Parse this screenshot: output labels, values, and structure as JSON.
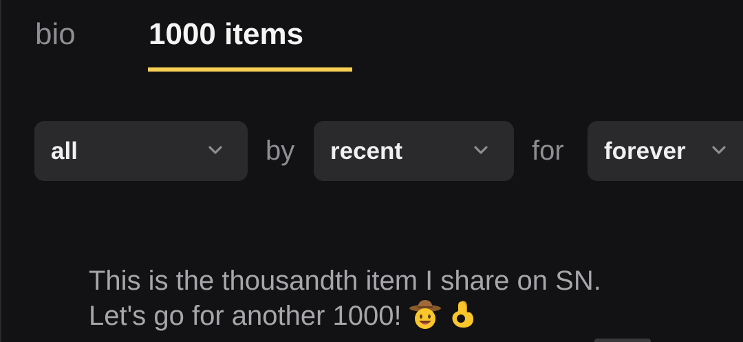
{
  "tabs": {
    "bio_label": "bio",
    "items_label": "1000 items",
    "active": "items"
  },
  "filters": {
    "type_value": "all",
    "by_label": "by",
    "sort_value": "recent",
    "for_label": "for",
    "when_value": "forever"
  },
  "post": {
    "line1": "This is the thousandth item I share on SN.",
    "line2": "Let's go for another 1000!",
    "emoji_icons": [
      "cowboy-hat-face-icon",
      "ok-hand-icon"
    ]
  },
  "colors": {
    "background": "#121214",
    "accent_underline": "#f6d155",
    "select_bg": "#2a2a2d"
  }
}
